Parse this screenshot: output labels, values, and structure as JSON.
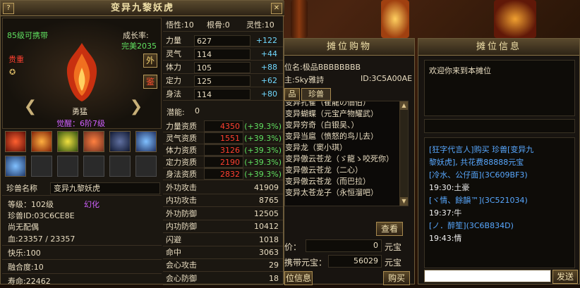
{
  "pet_window": {
    "title": "变异九黎妖虎",
    "level_text": "85级可携带",
    "growth_label": "成长率:",
    "growth_value": "完美2035",
    "rarity": "贵重",
    "temperament": "勇猛",
    "awaken": "觉醒：6阶7级",
    "btn_out": "外",
    "btn_appraise": "鉴",
    "attrs_top": {
      "wu": "悟性:10",
      "gen": "根骨:0",
      "ling": "灵性:10"
    },
    "stats": [
      {
        "label": "力量",
        "value": "627",
        "bonus": "+122"
      },
      {
        "label": "灵气",
        "value": "114",
        "bonus": "+44"
      },
      {
        "label": "体力",
        "value": "105",
        "bonus": "+88"
      },
      {
        "label": "定力",
        "value": "125",
        "bonus": "+62"
      },
      {
        "label": "身法",
        "value": "114",
        "bonus": "+80"
      }
    ],
    "potential_label": "潜能:",
    "potential_value": "0",
    "aptitudes": [
      {
        "label": "力量资质",
        "value": "4350",
        "bonus": "(+39.3%)"
      },
      {
        "label": "灵气资质",
        "value": "1551",
        "bonus": "(+39.3%)"
      },
      {
        "label": "体力资质",
        "value": "3126",
        "bonus": "(+39.3%)"
      },
      {
        "label": "定力资质",
        "value": "2190",
        "bonus": "(+39.3%)"
      },
      {
        "label": "身法资质",
        "value": "2832",
        "bonus": "(+39.3%)"
      }
    ],
    "pet_name_label": "珍兽名称",
    "pet_name_value": "变异九黎妖虎",
    "grade": "等级：102级",
    "transform": "幻化",
    "pet_id": "珍兽ID:03C6CE8E",
    "mate": "尚无配偶",
    "hp": "血:23357 / 23357",
    "happy": "快乐:100",
    "fusion": "融合度:10",
    "life": "寿命:22462",
    "combat": [
      {
        "label": "外功攻击",
        "value": "41909"
      },
      {
        "label": "内功攻击",
        "value": "8765"
      },
      {
        "label": "外功防御",
        "value": "12505"
      },
      {
        "label": "内功防御",
        "value": "10412"
      },
      {
        "label": "闪避",
        "value": "1018"
      },
      {
        "label": "命中",
        "value": "3063"
      },
      {
        "label": "会心攻击",
        "value": "29"
      },
      {
        "label": "会心防御",
        "value": "18"
      }
    ]
  },
  "shop": {
    "title": "摊位购物",
    "stall_name": "位名:极品BBBBBBBB",
    "owner": "主:Sky雅詩",
    "owner_id": "ID:3C5A00AE",
    "tab_item": "品",
    "tab_pet": "珍兽",
    "items": [
      "变异孔雀（崔龍の佃伯）",
      "变异蝴蝶（元宝产物耀武）",
      "变异穷奇（白银吴、）",
      "变异当扈（愤怒的鸟儿去）",
      "变异龙（窦小琪）",
      "变异傲云苍龙（ゞ龍ゝ咬死你）",
      "变异傲云苍龙（二心）",
      "变异傲云苍龙（而巴拉）",
      "变异太苍龙子（永恒溜吧）"
    ],
    "view_btn": "查看",
    "price_label": "价：",
    "price_value": "0",
    "price_unit": "元宝",
    "carry_label": "携带元宝：",
    "carry_value": "56029",
    "carry_unit": "元宝",
    "stall_info_tab": "位信息",
    "buy_btn": "购买"
  },
  "info": {
    "title": "摊位信息",
    "welcome": "欢迎你来到本摊位",
    "chat": [
      {
        "text": "[狂字代言人]购买 珍兽[变异九",
        "color": "#58a8ff"
      },
      {
        "text": "黎妖虎], 共花费88888元宝",
        "color": "#58a8ff"
      },
      {
        "text": "[冷水、公仔面](3C609BF3)",
        "color": "#58a8ff"
      },
      {
        "text": "19:30:土豪",
        "color": "#f0f0f0"
      },
      {
        "text": "[ヾ情、餘韻™](3C521034)",
        "color": "#58a8ff"
      },
      {
        "text": "19:37:牛",
        "color": "#f0f0f0"
      },
      {
        "text": "[ノ．醉笙](3C6B834D)",
        "color": "#58a8ff"
      },
      {
        "text": "19:43:情",
        "color": "#f0f0f0"
      }
    ],
    "send_btn": "发送",
    "input_value": ""
  }
}
